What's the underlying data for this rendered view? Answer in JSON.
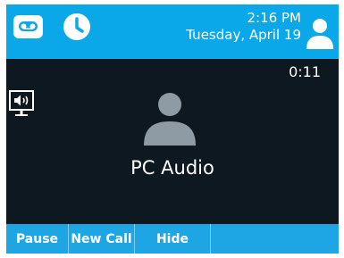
{
  "status_bar": {
    "time": "2:16 PM",
    "date": "Tuesday, April 19",
    "icons": [
      "voicemail-icon",
      "clock-icon",
      "user-avatar-icon"
    ]
  },
  "call": {
    "duration": "0:11",
    "caller_name": "PC Audio",
    "audio_mode_icon": "speaker-icon"
  },
  "softkeys": [
    "Pause",
    "New Call",
    "Hide",
    ""
  ],
  "colors": {
    "status_bar": "#0aa8e8",
    "background": "#0e1820",
    "softkey_bar": "#1ea6e4",
    "avatar": "#8e9aa4"
  }
}
